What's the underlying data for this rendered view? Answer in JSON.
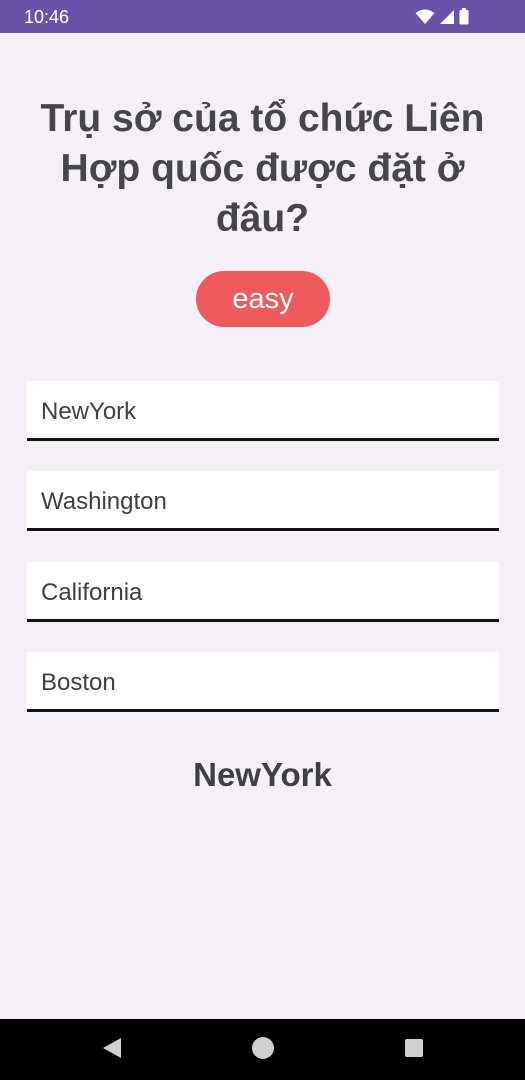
{
  "status_bar": {
    "time": "10:46",
    "icons": [
      "wifi-icon",
      "signal-icon",
      "battery-icon"
    ],
    "background": "#6a52a8"
  },
  "quiz": {
    "question": "Trụ sở của tổ chức Liên Hợp quốc được đặt ở đâu?",
    "difficulty": "easy",
    "difficulty_color": "#ee5b5f",
    "options": [
      {
        "label": "NewYork"
      },
      {
        "label": "Washington"
      },
      {
        "label": "California"
      },
      {
        "label": "Boston"
      }
    ],
    "answer": "NewYork"
  },
  "nav_bar": {
    "icons": [
      "back-icon",
      "home-icon",
      "recents-icon"
    ]
  }
}
